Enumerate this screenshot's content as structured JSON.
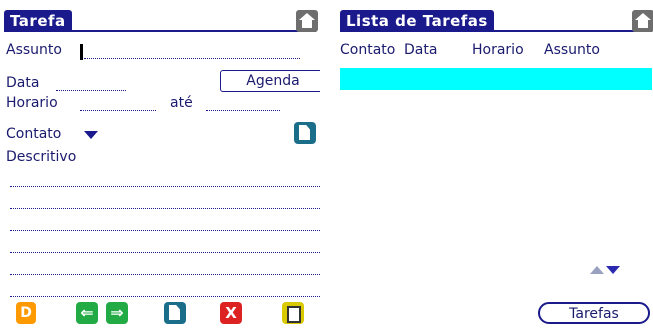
{
  "left": {
    "title": "Tarefa",
    "fields": {
      "assunto_label": "Assunto",
      "assunto_value": "",
      "data_label": "Data",
      "horario_label": "Horario",
      "ate_label": "até",
      "contato_label": "Contato",
      "descritivo_label": "Descritivo"
    },
    "agenda_button": "Agenda",
    "toolbar": {
      "d_label": "D",
      "back_label": "⇐",
      "forward_label": "⇒",
      "delete_label": "X"
    }
  },
  "right": {
    "title": "Lista de Tarefas",
    "columns": [
      "Contato",
      "Data",
      "Horario",
      "Assunto"
    ],
    "tarefas_button": "Tarefas"
  },
  "colors": {
    "accent": "#1a1a8c",
    "selection": "#00ffff"
  }
}
